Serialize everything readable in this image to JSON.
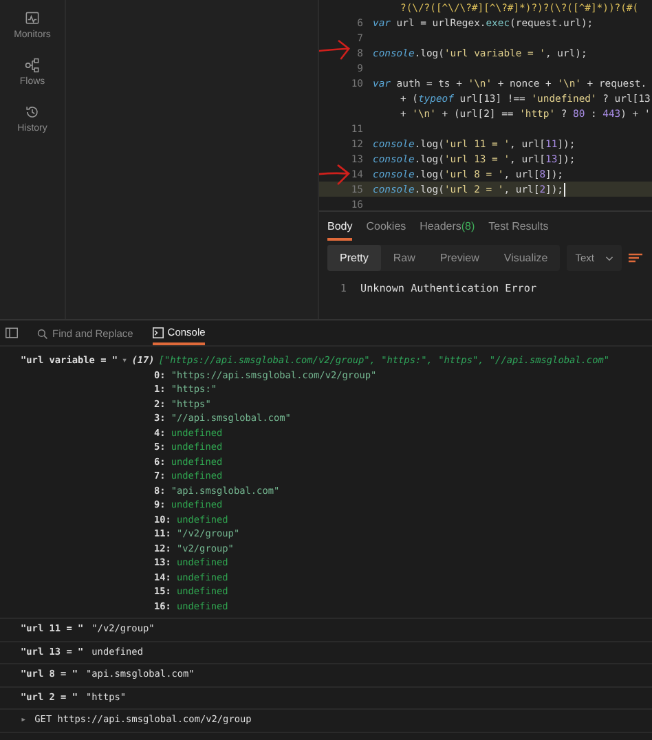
{
  "sidebar": {
    "items": [
      {
        "label": "Monitors",
        "selected": false
      },
      {
        "label": "Flows",
        "selected": false
      },
      {
        "label": "History",
        "selected": false
      }
    ]
  },
  "editor": {
    "lines": [
      {
        "highlighted": false,
        "segments": [
          {
            "kind": "re",
            "text": "?(\\/?([^\\/\\?#][^\\?#]*)?)?(\\?([^#]*))?(#("
          }
        ]
      },
      {
        "number": "6",
        "highlighted": false,
        "segments": [
          {
            "kind": "kw",
            "text": "var"
          },
          {
            "kind": "plain",
            "text": " url = urlRegex."
          },
          {
            "kind": "fn",
            "text": "exec"
          },
          {
            "kind": "plain",
            "text": "(request.url);"
          }
        ]
      },
      {
        "number": "7",
        "highlighted": false
      },
      {
        "number": "8",
        "highlighted": false,
        "segments": [
          {
            "kind": "kw",
            "text": "console"
          },
          {
            "kind": "plain",
            "text": ".log("
          },
          {
            "kind": "str",
            "text": "'url variable = '"
          },
          {
            "kind": "plain",
            "text": ", url);"
          }
        ]
      },
      {
        "number": "9",
        "highlighted": false
      },
      {
        "number": "10",
        "highlighted": false,
        "segments": [
          {
            "kind": "kw",
            "text": "var"
          },
          {
            "kind": "plain",
            "text": " auth = ts + "
          },
          {
            "kind": "str",
            "text": "'\\n'"
          },
          {
            "kind": "plain",
            "text": " + nonce + "
          },
          {
            "kind": "str",
            "text": "'\\n'"
          },
          {
            "kind": "plain",
            "text": " + request."
          }
        ]
      },
      {
        "highlighted": false,
        "segments": [
          {
            "kind": "plain",
            "text": "+ ("
          },
          {
            "kind": "kw",
            "text": "typeof"
          },
          {
            "kind": "plain",
            "text": " url[13] !== "
          },
          {
            "kind": "str",
            "text": "'undefined'"
          },
          {
            "kind": "plain",
            "text": " ? url[13"
          }
        ]
      },
      {
        "highlighted": false,
        "segments": [
          {
            "kind": "plain",
            "text": "+ "
          },
          {
            "kind": "str",
            "text": "'\\n'"
          },
          {
            "kind": "plain",
            "text": " + (url[2] == "
          },
          {
            "kind": "str",
            "text": "'http'"
          },
          {
            "kind": "plain",
            "text": " ? "
          },
          {
            "kind": "num",
            "text": "80"
          },
          {
            "kind": "plain",
            "text": " : "
          },
          {
            "kind": "num",
            "text": "443"
          },
          {
            "kind": "plain",
            "text": ") + '"
          }
        ]
      },
      {
        "number": "11",
        "highlighted": false
      },
      {
        "number": "12",
        "highlighted": false,
        "segments": [
          {
            "kind": "kw",
            "text": "console"
          },
          {
            "kind": "plain",
            "text": ".log("
          },
          {
            "kind": "str",
            "text": "'url 11 = '"
          },
          {
            "kind": "plain",
            "text": ", url["
          },
          {
            "kind": "num",
            "text": "11"
          },
          {
            "kind": "plain",
            "text": "]);"
          }
        ]
      },
      {
        "number": "13",
        "highlighted": false,
        "segments": [
          {
            "kind": "kw",
            "text": "console"
          },
          {
            "kind": "plain",
            "text": ".log("
          },
          {
            "kind": "str",
            "text": "'url 13 = '"
          },
          {
            "kind": "plain",
            "text": ", url["
          },
          {
            "kind": "num",
            "text": "13"
          },
          {
            "kind": "plain",
            "text": "]);"
          }
        ]
      },
      {
        "number": "14",
        "highlighted": false,
        "segments": [
          {
            "kind": "kw",
            "text": "console"
          },
          {
            "kind": "plain",
            "text": ".log("
          },
          {
            "kind": "str",
            "text": "'url 8 = '"
          },
          {
            "kind": "plain",
            "text": ", url["
          },
          {
            "kind": "num",
            "text": "8"
          },
          {
            "kind": "plain",
            "text": "]);"
          }
        ]
      },
      {
        "number": "15",
        "highlighted": true,
        "segments": [
          {
            "kind": "kw",
            "text": "console"
          },
          {
            "kind": "plain",
            "text": ".log("
          },
          {
            "kind": "str",
            "text": "'url 2 = '"
          },
          {
            "kind": "plain",
            "text": ", url["
          },
          {
            "kind": "num",
            "text": "2"
          },
          {
            "kind": "plain",
            "text": "]);"
          }
        ]
      },
      {
        "number": "16",
        "highlighted": false
      }
    ]
  },
  "response": {
    "tabs": [
      {
        "label": "Body",
        "selected": true
      },
      {
        "label": "Cookies",
        "selected": false
      },
      {
        "label": "Headers",
        "count": "(8)",
        "selected": false
      },
      {
        "label": "Test Results",
        "selected": false
      }
    ],
    "views": [
      {
        "label": "Pretty",
        "selected": true
      },
      {
        "label": "Raw",
        "selected": false
      },
      {
        "label": "Preview",
        "selected": false
      },
      {
        "label": "Visualize",
        "selected": false
      }
    ],
    "format": "Text",
    "body_lines": [
      {
        "number": "1",
        "text": "Unknown Authentication Error"
      }
    ]
  },
  "console_toolbar": {
    "tabs": [
      {
        "label": "Find and Replace",
        "selected": false
      },
      {
        "label": "Console",
        "selected": true
      }
    ]
  },
  "console": {
    "expanded_log": {
      "label": "\"url variable = \"",
      "expander": "▾",
      "count": "(17)",
      "preview": "[\"https://api.smsglobal.com/v2/group\", \"https:\", \"https\", \"//api.smsglobal.com\"",
      "items": [
        {
          "index": "0:",
          "value": "\"https://api.smsglobal.com/v2/group\"",
          "kind": "string"
        },
        {
          "index": "1:",
          "value": "\"https:\"",
          "kind": "string"
        },
        {
          "index": "2:",
          "value": "\"https\"",
          "kind": "string"
        },
        {
          "index": "3:",
          "value": "\"//api.smsglobal.com\"",
          "kind": "string"
        },
        {
          "index": "4:",
          "value": "undefined",
          "kind": "undefined"
        },
        {
          "index": "5:",
          "value": "undefined",
          "kind": "undefined"
        },
        {
          "index": "6:",
          "value": "undefined",
          "kind": "undefined"
        },
        {
          "index": "7:",
          "value": "undefined",
          "kind": "undefined"
        },
        {
          "index": "8:",
          "value": "\"api.smsglobal.com\"",
          "kind": "string"
        },
        {
          "index": "9:",
          "value": "undefined",
          "kind": "undefined"
        },
        {
          "index": "10:",
          "value": "undefined",
          "kind": "undefined"
        },
        {
          "index": "11:",
          "value": "\"/v2/group\"",
          "kind": "string"
        },
        {
          "index": "12:",
          "value": "\"v2/group\"",
          "kind": "string"
        },
        {
          "index": "13:",
          "value": "undefined",
          "kind": "undefined"
        },
        {
          "index": "14:",
          "value": "undefined",
          "kind": "undefined"
        },
        {
          "index": "15:",
          "value": "undefined",
          "kind": "undefined"
        },
        {
          "index": "16:",
          "value": "undefined",
          "kind": "undefined"
        }
      ]
    },
    "logs": [
      {
        "label": "\"url 11 = \"",
        "value": "\"/v2/group\""
      },
      {
        "label": "\"url 13 = \"",
        "value": "undefined"
      },
      {
        "label": "\"url 8 = \"",
        "value": "\"api.smsglobal.com\""
      },
      {
        "label": "\"url 2 = \"",
        "value": "\"https\""
      }
    ],
    "request": {
      "expander": "▸",
      "text": "GET https://api.smsglobal.com/v2/group"
    }
  }
}
